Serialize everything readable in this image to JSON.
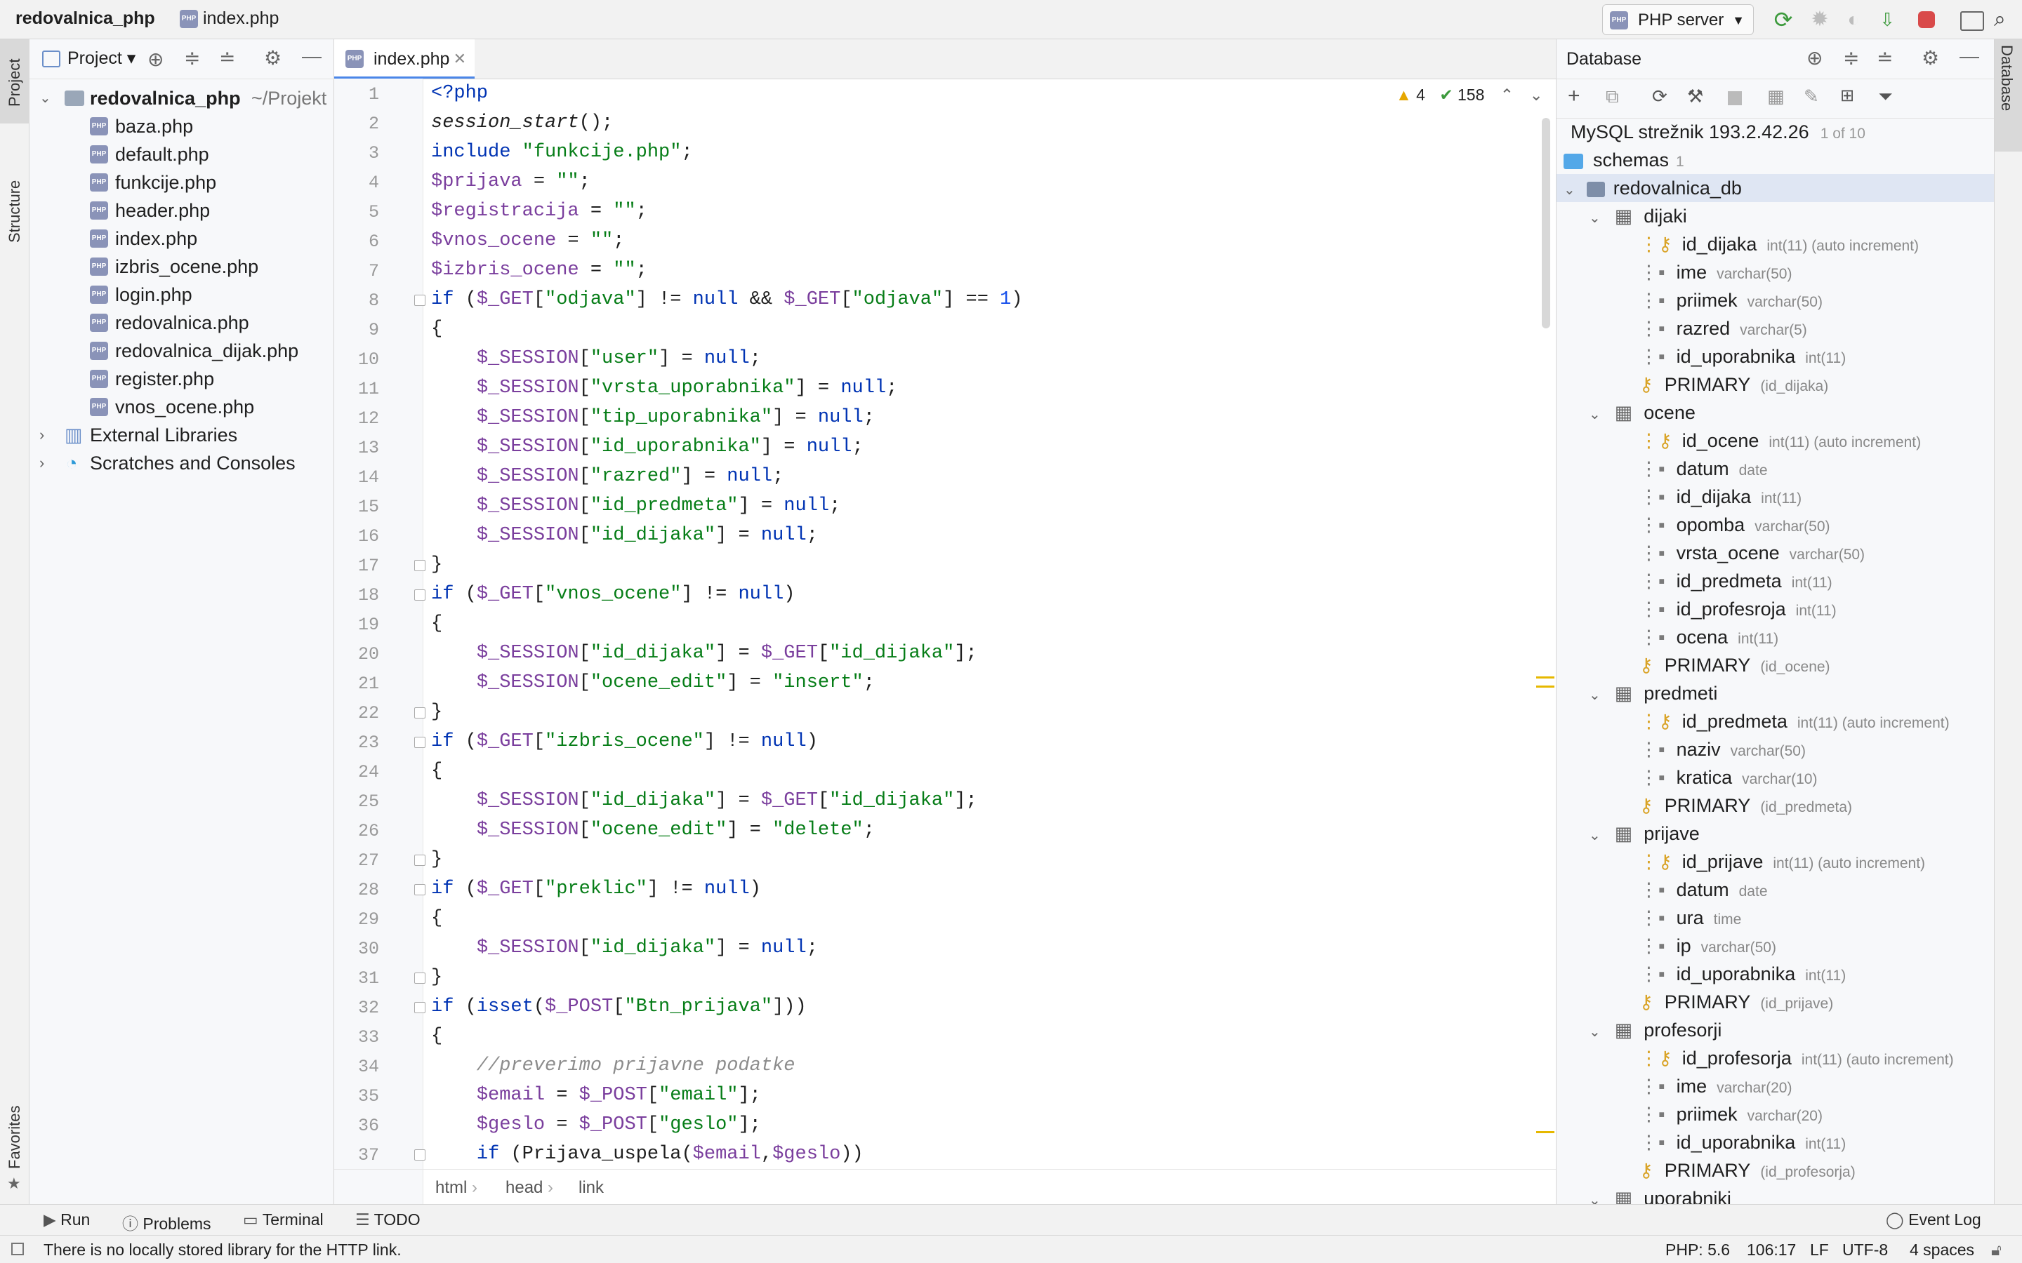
{
  "titlebar": {
    "project_name": "redovalnica_php",
    "file_name": "index.php",
    "run_config": "PHP server"
  },
  "left_stripe": {
    "project_label": "Project",
    "structure_label": "Structure",
    "favorites_label": "Favorites"
  },
  "project_panel": {
    "header": "Project",
    "root": {
      "name": "redovalnica_php",
      "path": "~/Projekt"
    },
    "files": [
      "baza.php",
      "default.php",
      "funkcije.php",
      "header.php",
      "index.php",
      "izbris_ocene.php",
      "login.php",
      "redovalnica.php",
      "redovalnica_dijak.php",
      "register.php",
      "vnos_ocene.php"
    ],
    "external_libraries": "External Libraries",
    "scratches": "Scratches and Consoles"
  },
  "editor": {
    "tab_label": "index.php",
    "warnings": "4",
    "checks": "158",
    "line_numbers": [
      "1",
      "2",
      "3",
      "4",
      "5",
      "6",
      "7",
      "8",
      "9",
      "10",
      "11",
      "12",
      "13",
      "14",
      "15",
      "16",
      "17",
      "18",
      "19",
      "20",
      "21",
      "22",
      "23",
      "24",
      "25",
      "26",
      "27",
      "28",
      "29",
      "30",
      "31",
      "32",
      "33",
      "34",
      "35",
      "36",
      "37"
    ],
    "lines": [
      "<?php",
      "session_start();",
      "include \"funkcije.php\";",
      "$prijava = \"\";",
      "$registracija = \"\";",
      "$vnos_ocene = \"\";",
      "$izbris_ocene = \"\";",
      "if ($_GET[\"odjava\"] != null && $_GET[\"odjava\"] == 1)",
      "{",
      "    $_SESSION[\"user\"] = null;",
      "    $_SESSION[\"vrsta_uporabnika\"] = null;",
      "    $_SESSION[\"tip_uporabnika\"] = null;",
      "    $_SESSION[\"id_uporabnika\"] = null;",
      "    $_SESSION[\"razred\"] = null;",
      "    $_SESSION[\"id_predmeta\"] = null;",
      "    $_SESSION[\"id_dijaka\"] = null;",
      "}",
      "if ($_GET[\"vnos_ocene\"] != null)",
      "{",
      "    $_SESSION[\"id_dijaka\"] = $_GET[\"id_dijaka\"];",
      "    $_SESSION[\"ocene_edit\"] = \"insert\";",
      "}",
      "if ($_GET[\"izbris_ocene\"] != null)",
      "{",
      "    $_SESSION[\"id_dijaka\"] = $_GET[\"id_dijaka\"];",
      "    $_SESSION[\"ocene_edit\"] = \"delete\";",
      "}",
      "if ($_GET[\"preklic\"] != null)",
      "{",
      "    $_SESSION[\"id_dijaka\"] = null;",
      "}",
      "if (isset($_POST[\"Btn_prijava\"]))",
      "{",
      "    //preverimo prijavne podatke",
      "    $email = $_POST[\"email\"];",
      "    $geslo = $_POST[\"geslo\"];",
      "    if (Prijava_uspela($email,$geslo))"
    ],
    "breadcrumb": [
      "html",
      "head",
      "link"
    ]
  },
  "database": {
    "header": "Database",
    "server": "MySQL strežnik 193.2.42.26",
    "server_count": "1 of 10",
    "schemas": "schemas",
    "schemas_count": "1",
    "db": "redovalnica_db",
    "tables": [
      {
        "name": "dijaki",
        "columns": [
          {
            "name": "id_dijaka",
            "type": "int(11) (auto increment)",
            "key": true
          },
          {
            "name": "ime",
            "type": "varchar(50)"
          },
          {
            "name": "priimek",
            "type": "varchar(50)"
          },
          {
            "name": "razred",
            "type": "varchar(5)"
          },
          {
            "name": "id_uporabnika",
            "type": "int(11)"
          },
          {
            "name": "PRIMARY",
            "type": "(id_dijaka)",
            "primary": true
          }
        ]
      },
      {
        "name": "ocene",
        "columns": [
          {
            "name": "id_ocene",
            "type": "int(11) (auto increment)",
            "key": true
          },
          {
            "name": "datum",
            "type": "date"
          },
          {
            "name": "id_dijaka",
            "type": "int(11)"
          },
          {
            "name": "opomba",
            "type": "varchar(50)"
          },
          {
            "name": "vrsta_ocene",
            "type": "varchar(50)"
          },
          {
            "name": "id_predmeta",
            "type": "int(11)"
          },
          {
            "name": "id_profesroja",
            "type": "int(11)"
          },
          {
            "name": "ocena",
            "type": "int(11)"
          },
          {
            "name": "PRIMARY",
            "type": "(id_ocene)",
            "primary": true
          }
        ]
      },
      {
        "name": "predmeti",
        "columns": [
          {
            "name": "id_predmeta",
            "type": "int(11) (auto increment)",
            "key": true
          },
          {
            "name": "naziv",
            "type": "varchar(50)"
          },
          {
            "name": "kratica",
            "type": "varchar(10)"
          },
          {
            "name": "PRIMARY",
            "type": "(id_predmeta)",
            "primary": true
          }
        ]
      },
      {
        "name": "prijave",
        "columns": [
          {
            "name": "id_prijave",
            "type": "int(11) (auto increment)",
            "key": true
          },
          {
            "name": "datum",
            "type": "date"
          },
          {
            "name": "ura",
            "type": "time"
          },
          {
            "name": "ip",
            "type": "varchar(50)"
          },
          {
            "name": "id_uporabnika",
            "type": "int(11)"
          },
          {
            "name": "PRIMARY",
            "type": "(id_prijave)",
            "primary": true
          }
        ]
      },
      {
        "name": "profesorji",
        "columns": [
          {
            "name": "id_profesorja",
            "type": "int(11) (auto increment)",
            "key": true
          },
          {
            "name": "ime",
            "type": "varchar(20)"
          },
          {
            "name": "priimek",
            "type": "varchar(20)"
          },
          {
            "name": "id_uporabnika",
            "type": "int(11)"
          },
          {
            "name": "PRIMARY",
            "type": "(id_profesorja)",
            "primary": true
          }
        ]
      },
      {
        "name": "uporabniki",
        "columns": []
      }
    ],
    "right_stripe_label": "Database"
  },
  "bottom_tools": {
    "run": "Run",
    "problems": "Problems",
    "terminal": "Terminal",
    "todo": "TODO",
    "event_log": "Event Log"
  },
  "status": {
    "message": "There is no locally stored library for the HTTP link.",
    "php_version": "PHP: 5.6",
    "position": "106:17",
    "line_sep": "LF",
    "encoding": "UTF-8",
    "indent": "4 spaces"
  },
  "colors": {
    "accent": "#4a86e8",
    "keyword": "#0033b3",
    "string": "#067d17",
    "variable": "#7a3e9d",
    "number": "#1750eb"
  }
}
